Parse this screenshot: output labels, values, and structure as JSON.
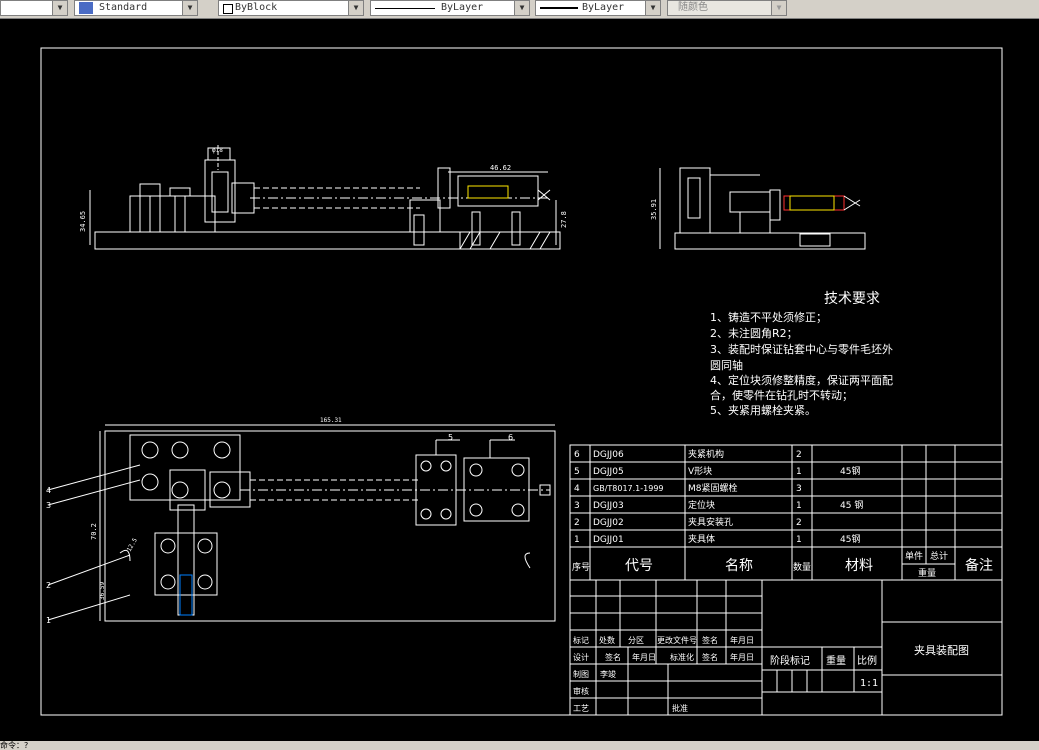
{
  "toolbar": {
    "text_style": "Standard",
    "layer_color": "ByBlock",
    "linetype": "ByLayer",
    "lineweight": "ByLayer",
    "plot_style": "随颜色"
  },
  "dims": {
    "front_top_width": "46.62",
    "front_height_left": "34.65",
    "front_height_right": "27.8",
    "top_small": "φ18",
    "side_height": "35.91",
    "plan_width": "165.31",
    "plan_height_a": "70.2",
    "plan_height_b": "36.59",
    "plan_small": "12.5"
  },
  "balloons": [
    "4",
    "3",
    "2",
    "1",
    "5",
    "6"
  ],
  "tech": {
    "title": "技术要求",
    "lines": [
      "1、铸造不平处须修正；",
      "2、未注圆角R2；",
      "3、装配时保证钻套中心与零件毛坯外",
      "圆同轴",
      "4、定位块须修整精度，保证两平面配",
      "合，使零件在钻孔时不转动；",
      "5、夹紧用螺栓夹紧。"
    ]
  },
  "bom": {
    "rows": [
      {
        "no": "6",
        "code": "DGJJ06",
        "name": "夹紧机构",
        "qty": "2",
        "material": ""
      },
      {
        "no": "5",
        "code": "DGJJ05",
        "name": "V形块",
        "qty": "1",
        "material": "45钢"
      },
      {
        "no": "4",
        "code": "GB/T8017.1-1999",
        "name": "M8紧固螺栓",
        "qty": "3",
        "material": ""
      },
      {
        "no": "3",
        "code": "DGJJ03",
        "name": "定位块",
        "qty": "1",
        "material": "45 钢"
      },
      {
        "no": "2",
        "code": "DGJJ02",
        "name": "夹具安装孔",
        "qty": "2",
        "material": ""
      },
      {
        "no": "1",
        "code": "DGJJ01",
        "name": "夹具体",
        "qty": "1",
        "material": "45钢"
      }
    ],
    "header": {
      "no": "序号",
      "code": "代号",
      "name": "名称",
      "qty": "数量",
      "material": "材料",
      "single": "单件",
      "total": "总计",
      "weight": "重量",
      "remark": "备注"
    }
  },
  "titleblock": {
    "r1": [
      "标记",
      "处数",
      "分区",
      "更改文件号",
      "签名",
      "年月日"
    ],
    "r2": [
      "设计",
      "签名",
      "年月日",
      "标准化",
      "签名",
      "年月日"
    ],
    "r3a": "制图",
    "r3b": "李竣",
    "r4": "审核",
    "r5a": "工艺",
    "r5b": "批准",
    "stage": "阶段标记",
    "weight": "重量",
    "scale": "比例",
    "scale_val": "1:1",
    "drawing_name": "夹具装配图"
  },
  "status": {
    "prompt": "命令：?"
  }
}
